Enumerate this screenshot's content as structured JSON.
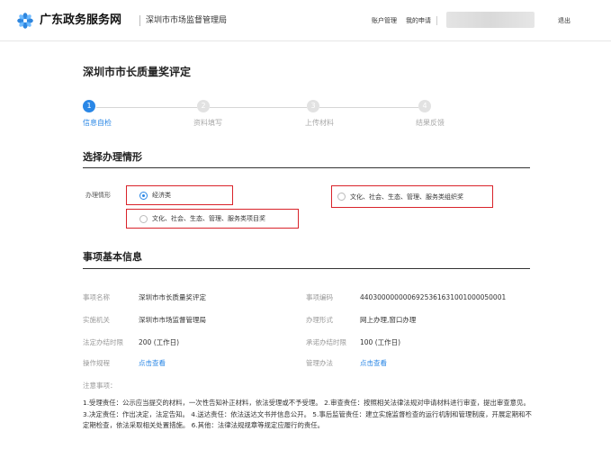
{
  "header": {
    "site_title": "广东政务服务网",
    "department": "深圳市市场监督管理局",
    "link_account": "账户管理",
    "link_applications": "我的申请",
    "logout": "退出"
  },
  "page": {
    "title": "深圳市市长质量奖评定"
  },
  "steps": [
    {
      "num": "1",
      "label": "信息自检",
      "active": true
    },
    {
      "num": "2",
      "label": "资料填写",
      "active": false
    },
    {
      "num": "3",
      "label": "上传材料",
      "active": false
    },
    {
      "num": "4",
      "label": "结果反馈",
      "active": false
    }
  ],
  "situation": {
    "heading": "选择办理情形",
    "field_label": "办理情形",
    "options": [
      {
        "label": "经济类",
        "checked": true
      },
      {
        "label": "文化、社会、生态、管理、服务类组织奖",
        "checked": false
      },
      {
        "label": "文化、社会、生态、管理、服务类项目奖",
        "checked": false
      }
    ]
  },
  "info": {
    "heading": "事项基本信息",
    "name_key": "事项名称",
    "name_val": "深圳市市长质量奖评定",
    "code_key": "事项编码",
    "code_val": "44030000000069253616310010000500​01",
    "agency_key": "实施机关",
    "agency_val": "深圳市市场监督管理局",
    "form_key": "办理形式",
    "form_val": "网上办理,窗口办理",
    "legal_key": "法定办结时限",
    "legal_val": "200 (工作日)",
    "promise_key": "承诺办结时限",
    "promise_val": "100 (工作日)",
    "procedure_key": "操作规程",
    "procedure_val": "点击查看",
    "mgmt_key": "管理办法",
    "mgmt_val": "点击查看",
    "notes_label": "注意事项：",
    "notes_text": "1.受理责任：公示应当提交的材料，一次性告知补正材料，依法受理或不予受理。 2.审查责任：按照相关法律法规对申请材料进行审查，提出审查意见。 3.决定责任：作出决定，法定告知。 4.送达责任：依法送达文书并信息公开。 5.事后监管责任：建立实施监督检查的运行机制和管理制度，开展定期和不定期检查，依法采取相关处置措施。 6.其他：法律法规规章等规定应履行的责任。"
  },
  "colors": {
    "accent": "#2a87e6",
    "highlight_box": "#d9232a",
    "logo": "#2e86de"
  },
  "icons": {
    "logo": "gov-service-logo-icon"
  }
}
